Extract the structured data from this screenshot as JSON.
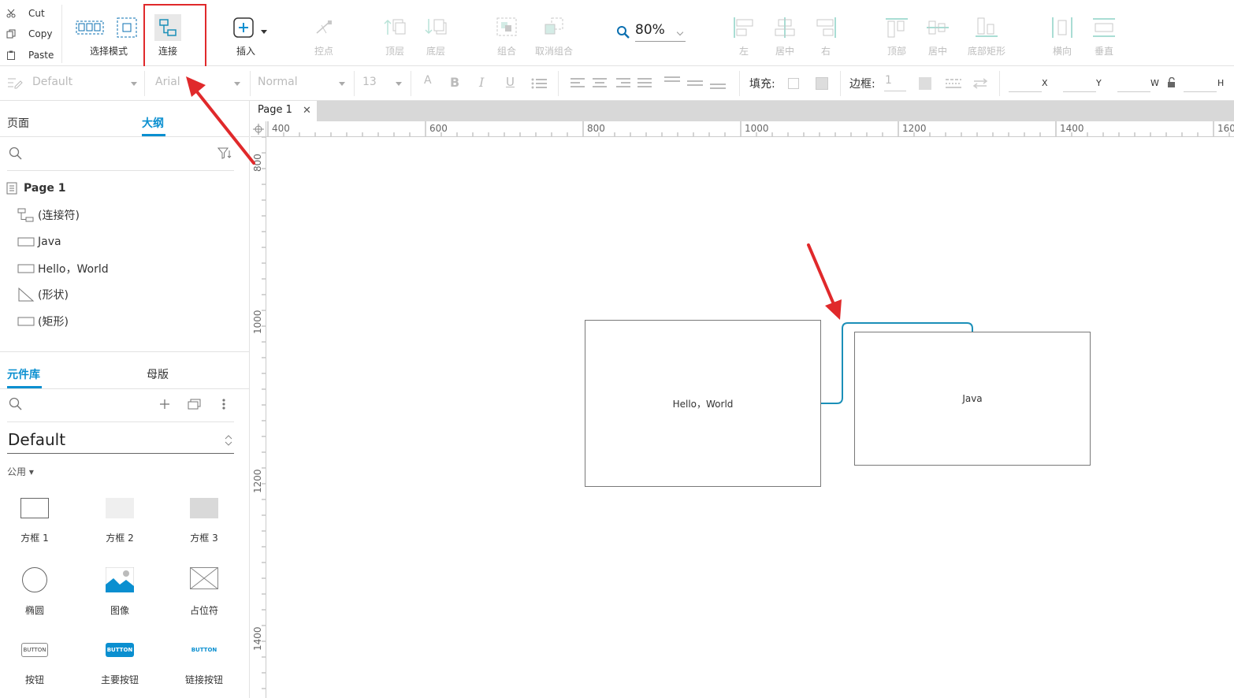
{
  "clipboard": {
    "cut": "Cut",
    "copy": "Copy",
    "paste": "Paste"
  },
  "toolbar": {
    "select_mode": "选择模式",
    "connect": "连接",
    "insert": "插入",
    "anchor": "控点",
    "top_layer": "顶层",
    "bottom_layer": "底层",
    "group": "组合",
    "ungroup": "取消组合",
    "zoom": "80%",
    "align_left": "左",
    "align_center": "居中",
    "align_right": "右",
    "align_top": "顶部",
    "align_middle": "居中",
    "align_bottom": "底部矩形",
    "distribute_h": "横向",
    "distribute_v": "垂直"
  },
  "format": {
    "style": "Default",
    "font": "Arial",
    "weight": "Normal",
    "size": "13",
    "fill_label": "填充:",
    "border_label": "边框:",
    "border_width": "1",
    "x": "X",
    "y": "Y",
    "w": "W",
    "h": "H"
  },
  "left": {
    "tab_pages": "页面",
    "tab_outline": "大纲",
    "outline": {
      "page": "Page 1",
      "items": [
        "(连接符)",
        "Java",
        "Hello，World",
        "(形状)",
        "(矩形)"
      ]
    },
    "tab_library": "元件库",
    "tab_masters": "母版",
    "library_name": "Default",
    "category": "公用 ▾",
    "widgets": [
      "方框 1",
      "方框 2",
      "方框 3",
      "椭圆",
      "图像",
      "占位符",
      "按钮",
      "主要按钮",
      "链接按钮"
    ],
    "button_text": "BUTTON"
  },
  "canvas": {
    "page_tab": "Page 1",
    "ruler_h": [
      "400",
      "600",
      "800",
      "1000",
      "1200",
      "1400",
      "160"
    ],
    "ruler_v": [
      "800",
      "1000",
      "1200",
      "1400"
    ],
    "shape_hello": "Hello，World",
    "shape_java": "Java"
  },
  "colors": {
    "accent": "#0a8fd0",
    "connector": "#1b8fb8",
    "annotation": "#e0292b"
  }
}
